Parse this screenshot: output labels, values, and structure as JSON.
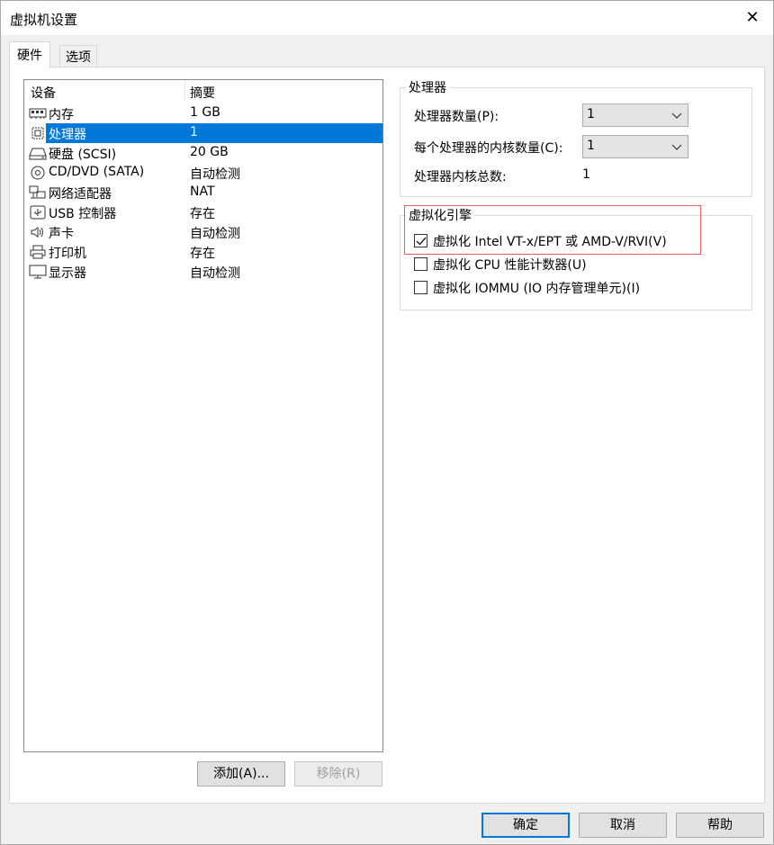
{
  "window": {
    "title": "虚拟机设置",
    "close_glyph": "✕"
  },
  "tabs": [
    {
      "label": "硬件"
    },
    {
      "label": "选项"
    }
  ],
  "device_list": {
    "col_device": "设备",
    "col_summary": "摘要",
    "rows": [
      {
        "name": "内存",
        "summary": "1 GB",
        "icon": "memory-icon"
      },
      {
        "name": "处理器",
        "summary": "1",
        "icon": "processor-icon",
        "selected": true
      },
      {
        "name": "硬盘 (SCSI)",
        "summary": "20 GB",
        "icon": "hard-disk-icon"
      },
      {
        "name": "CD/DVD (SATA)",
        "summary": "自动检测",
        "icon": "cd-dvd-icon"
      },
      {
        "name": "网络适配器",
        "summary": "NAT",
        "icon": "network-adapter-icon"
      },
      {
        "name": "USB 控制器",
        "summary": "存在",
        "icon": "usb-icon"
      },
      {
        "name": "声卡",
        "summary": "自动检测",
        "icon": "sound-card-icon"
      },
      {
        "name": "打印机",
        "summary": "存在",
        "icon": "printer-icon"
      },
      {
        "name": "显示器",
        "summary": "自动检测",
        "icon": "display-icon"
      }
    ]
  },
  "buttons": {
    "add": "添加(A)...",
    "remove": "移除(R)",
    "ok": "确定",
    "cancel": "取消",
    "help": "帮助"
  },
  "processor_group": {
    "legend": "处理器",
    "count_label": "处理器数量(P):",
    "count_value": "1",
    "cores_label": "每个处理器的内核数量(C):",
    "cores_value": "1",
    "total_label": "处理器内核总数:",
    "total_value": "1"
  },
  "virtualization_group": {
    "legend": "虚拟化引擎",
    "options": [
      {
        "label": "虚拟化 Intel VT-x/EPT 或 AMD-V/RVI(V)",
        "checked": true
      },
      {
        "label": "虚拟化 CPU 性能计数器(U)",
        "checked": false
      },
      {
        "label": "虚拟化 IOMMU (IO 内存管理单元)(I)",
        "checked": false
      }
    ]
  },
  "colors": {
    "selection": "#0078d7",
    "highlight_box": "#e06060"
  }
}
